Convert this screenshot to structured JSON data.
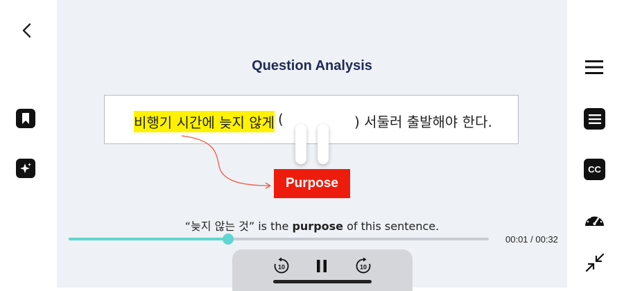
{
  "title": "Question Analysis",
  "sentence": {
    "highlighted": "비행기 시간에 늦지 않게",
    "blank_open": "(",
    "after_blank": ") 서둘러 출발해야 한다."
  },
  "label_button": "Purpose",
  "caption": {
    "prefix": "“늦지 않는 것” is the ",
    "bold": "purpose",
    "suffix": " of this sentence."
  },
  "player": {
    "time": "00:01 / 00:32",
    "progress": 0.38,
    "replay_10_label": "10",
    "forward_10_label": "10",
    "state": "paused-overlay"
  },
  "left_toolbar": [
    "back-icon",
    "bookmark-icon",
    "sparkles-icon"
  ],
  "right_toolbar": [
    "menu-icon",
    "list-icon",
    "closed-captions-icon",
    "speed-gauge-icon",
    "minimize-icon"
  ],
  "right_cc_label": "CC",
  "colors": {
    "highlight": "#fff200",
    "accent": "#ee1c0c",
    "progress": "#5fd6cf",
    "title": "#1f2a56"
  }
}
